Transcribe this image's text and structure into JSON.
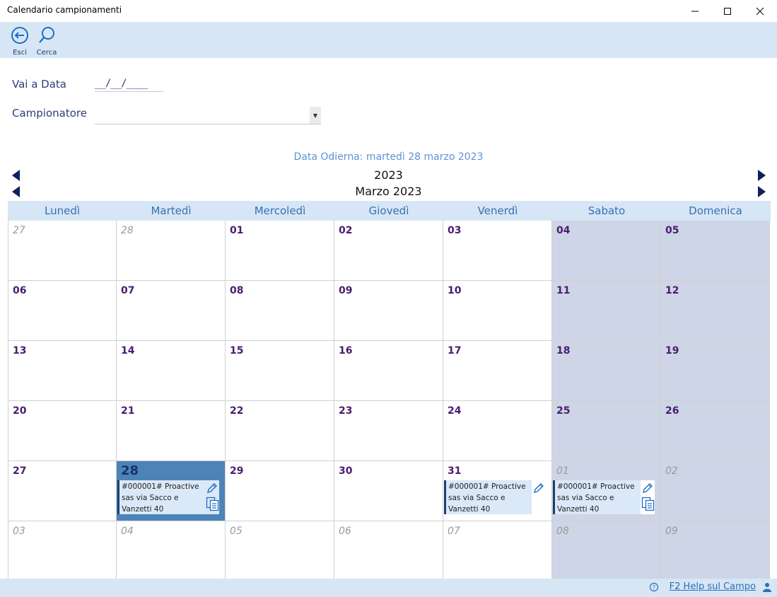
{
  "window": {
    "title": "Calendario campionamenti"
  },
  "toolbar": {
    "exit_label": "Esci",
    "search_label": "Cerca"
  },
  "form": {
    "go_to_date_label": "Vai a Data",
    "date_value": "__/__/____",
    "sampler_label": "Campionatore",
    "sampler_value": ""
  },
  "header": {
    "today_text": "Data Odierna: martedì 28 marzo 2023",
    "year": "2023",
    "month": "Marzo 2023"
  },
  "calendar": {
    "weekdays": [
      "Lunedì",
      "Martedì",
      "Mercoledì",
      "Giovedì",
      "Venerdì",
      "Sabato",
      "Domenica"
    ],
    "weeks": [
      [
        {
          "day": "27",
          "out": true
        },
        {
          "day": "28",
          "out": true
        },
        {
          "day": "01"
        },
        {
          "day": "02"
        },
        {
          "day": "03"
        },
        {
          "day": "04",
          "weekend": true
        },
        {
          "day": "05",
          "weekend": true
        }
      ],
      [
        {
          "day": "06"
        },
        {
          "day": "07"
        },
        {
          "day": "08"
        },
        {
          "day": "09"
        },
        {
          "day": "10"
        },
        {
          "day": "11",
          "weekend": true
        },
        {
          "day": "12",
          "weekend": true
        }
      ],
      [
        {
          "day": "13"
        },
        {
          "day": "14"
        },
        {
          "day": "15"
        },
        {
          "day": "16"
        },
        {
          "day": "17"
        },
        {
          "day": "18",
          "weekend": true
        },
        {
          "day": "19",
          "weekend": true
        }
      ],
      [
        {
          "day": "20"
        },
        {
          "day": "21"
        },
        {
          "day": "22"
        },
        {
          "day": "23"
        },
        {
          "day": "24"
        },
        {
          "day": "25",
          "weekend": true
        },
        {
          "day": "26",
          "weekend": true
        }
      ],
      [
        {
          "day": "27"
        },
        {
          "day": "28",
          "today": true,
          "event": "#000001# Proactive sas via Sacco e Vanzetti 40",
          "copy": true
        },
        {
          "day": "29"
        },
        {
          "day": "30"
        },
        {
          "day": "31",
          "event": "#000001# Proactive sas via Sacco e Vanzetti 40",
          "copy": false
        },
        {
          "day": "01",
          "out": true,
          "weekend": true,
          "event": "#000001# Proactive sas via Sacco e Vanzetti 40",
          "copy": true
        },
        {
          "day": "02",
          "out": true,
          "weekend": true
        }
      ],
      [
        {
          "day": "03",
          "out": true
        },
        {
          "day": "04",
          "out": true
        },
        {
          "day": "05",
          "out": true
        },
        {
          "day": "06",
          "out": true
        },
        {
          "day": "07",
          "out": true
        },
        {
          "day": "08",
          "out": true,
          "weekend": true
        },
        {
          "day": "09",
          "out": true,
          "weekend": true
        }
      ]
    ]
  },
  "status": {
    "help_text": "F2 Help sul Campo"
  },
  "colors": {
    "accent": "#2d6fb5",
    "toolbar_bg": "#d6e6f5",
    "weekend_bg": "#cdd5e6",
    "today_bg": "#4d84b8",
    "day_number": "#4b1c6e"
  }
}
